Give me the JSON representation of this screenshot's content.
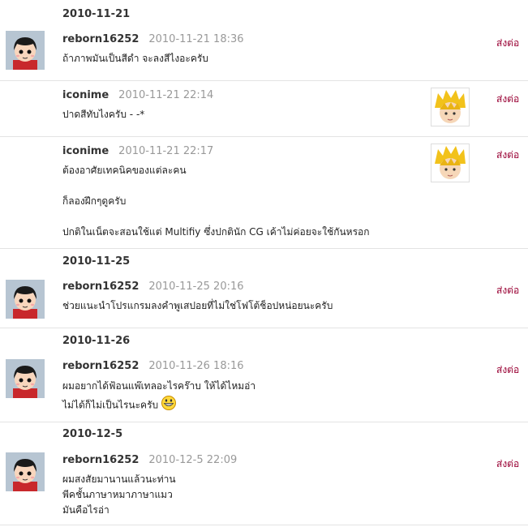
{
  "send_label": "ส่งต่อ",
  "dates": [
    "2010-11-21",
    "2010-11-25",
    "2010-11-26",
    "2010-12-5"
  ],
  "comments": [
    {
      "user": "reborn16252",
      "time": "2010-11-21 18:36",
      "lines": [
        "ถ้าภาพมันเป็นสีดำ  จะลงสีไงอะครับ"
      ]
    },
    {
      "user": "iconime",
      "time": "2010-11-21 22:14",
      "lines": [
        "ปาดสีทับไงครับ - -*"
      ]
    },
    {
      "user": "iconime",
      "time": "2010-11-21 22:17",
      "lines": [
        "ต้องอาศัยเทคนิคของแต่ละคน",
        "ก็ลองฝึกๆดูครับ",
        "ปกติในเน็ตจะสอนใช้แต่ Multifiy ซึ่งปกตินัก CG เค้าไม่ค่อยจะใช้กันหรอก"
      ]
    },
    {
      "user": "reborn16252",
      "time": "2010-11-25 20:16",
      "lines": [
        "ช่วยแนะนำโปรแกรมลงคำพูเสปอยที่ไม่ใช่โฟโต้ช็อปหน่อยนะครับ"
      ]
    },
    {
      "user": "reborn16252",
      "time": "2010-11-26 18:16",
      "lines": [
        "ผมอยากได้ฟ้อนแพ๊เทลอะไรคร๊าบ    ให้ได้ไหมอ่า",
        "ไม่ได้ก็ไม่เป็นไรนะครับ"
      ]
    },
    {
      "user": "reborn16252",
      "time": "2010-12-5 22:09",
      "lines": [
        "ผมสงสัยมานานแล้วนะท่าน",
        "พีคชั้นภาษาหมาภาษาแมว",
        "มันคือไรอ่า"
      ]
    }
  ]
}
